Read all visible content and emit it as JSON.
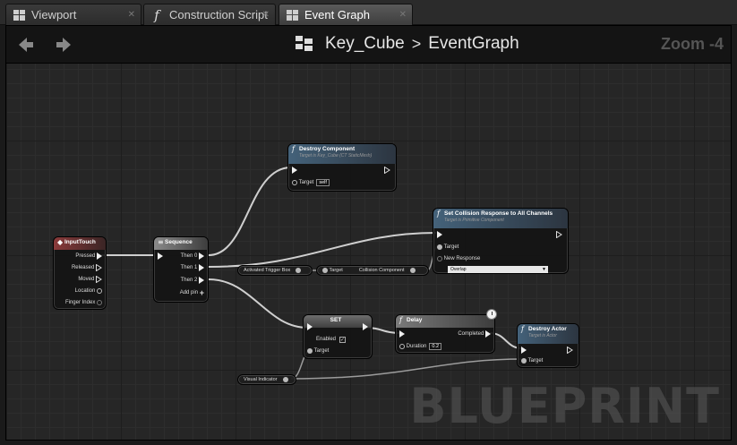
{
  "tabs": [
    {
      "label": "Viewport",
      "icon": "viewport-grid-icon",
      "active": false
    },
    {
      "label": "Construction Script",
      "icon": "function-icon",
      "active": false
    },
    {
      "label": "Event Graph",
      "icon": "event-graph-icon",
      "active": true
    }
  ],
  "header": {
    "blueprint_name": "Key_Cube",
    "separator": ">",
    "graph_name": "EventGraph",
    "zoom": "Zoom -4"
  },
  "watermark": "BLUEPRINT",
  "nodes": {
    "input_touch": {
      "title": "InputTouch",
      "pins": [
        "Pressed",
        "Released",
        "Moved",
        "Location",
        "Finger Index"
      ]
    },
    "sequence": {
      "title": "Sequence",
      "pins": [
        "Then 0",
        "Then 1",
        "Then 2",
        "Add pin"
      ]
    },
    "destroy_component": {
      "title": "Destroy Component",
      "subtitle": "Target is Key_Cube (CT StaticMesh)",
      "target_label": "Target",
      "target_value": "self"
    },
    "set_collision": {
      "title": "Set Collision Response to All Channels",
      "subtitle": "Target is Primitive Component",
      "target_label": "Target",
      "new_response_label": "New Response",
      "new_response_value": "Overlap"
    },
    "activated_trigger_box": {
      "label": "Activated Trigger Box"
    },
    "collision_component": {
      "target_label": "Target",
      "label": "Collision Component"
    },
    "set": {
      "title": "SET",
      "enabled_label": "Enabled",
      "enabled_checked": true,
      "target_label": "Target"
    },
    "delay": {
      "title": "Delay",
      "duration_label": "Duration",
      "duration_value": "0.2",
      "completed_label": "Completed"
    },
    "destroy_actor": {
      "title": "Destroy Actor",
      "subtitle": "Target is Actor",
      "target_label": "Target"
    },
    "visual_indicator": {
      "label": "Visual Indicator"
    }
  },
  "colors": {
    "exec_wire": "#d0d0d0",
    "background": "#262626",
    "header": "#141414"
  }
}
